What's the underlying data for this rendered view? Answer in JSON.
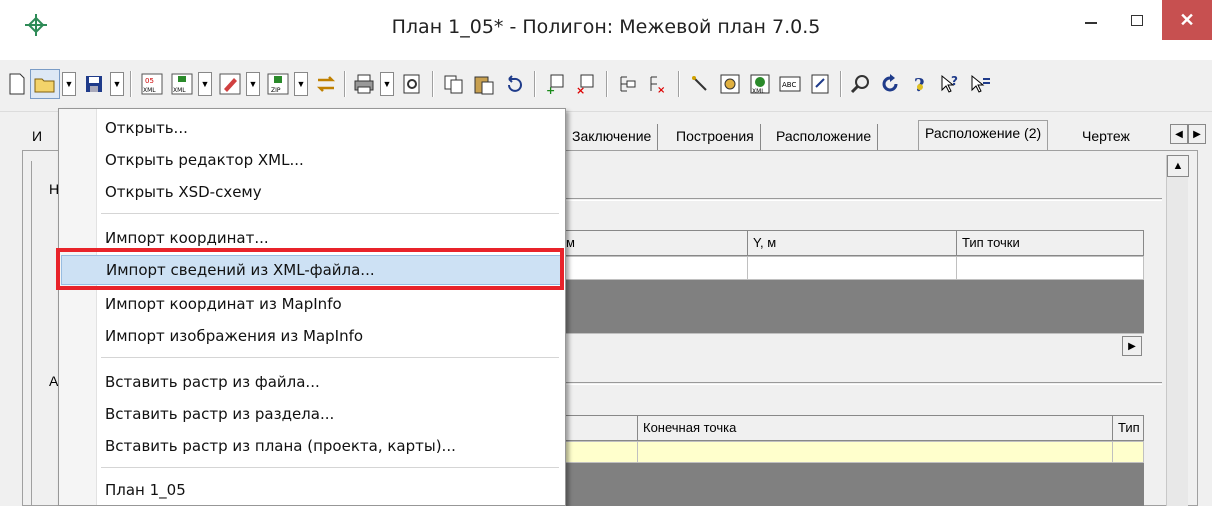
{
  "window": {
    "title": "План 1_05* - Полигон: Межевой план 7.0.5",
    "close_glyph": "✕"
  },
  "toolbar": {
    "icons": [
      "new-file-icon",
      "open-folder-icon",
      "save-icon",
      "export-xml-icon",
      "import-xml-icon",
      "edit-icon",
      "zip-icon",
      "exchange-icon",
      "print-icon",
      "preview-icon",
      "copy-icon",
      "paste-icon",
      "undo-icon",
      "add-point-icon",
      "delete-point-icon",
      "add-node-icon",
      "delete-node-icon",
      "draw-icon",
      "scan-icon",
      "xml-check-icon",
      "abc-icon",
      "frame-icon",
      "search-icon",
      "refresh-icon",
      "help-icon",
      "context-help-icon",
      "options-icon"
    ]
  },
  "tabs": {
    "partial_first": "И",
    "items": [
      "Заключение",
      "Построения",
      "Расположение",
      "Расположение (2)",
      "Чертеж"
    ],
    "active_index": 3
  },
  "content": {
    "left_letters": [
      "Н",
      "А"
    ]
  },
  "grid1": {
    "columns": [
      "м",
      "Y, м",
      "Тип точки"
    ]
  },
  "grid2": {
    "columns": [
      "Конечная точка",
      "Тип"
    ]
  },
  "menu": {
    "items": [
      "Открыть...",
      "Открыть редактор XML...",
      "Открыть XSD-схему",
      "Импорт координат...",
      "Импорт сведений из XML-файла...",
      "Импорт координат из MapInfo",
      "Импорт изображения из MapInfo",
      "Вставить растр из файла...",
      "Вставить растр из раздела...",
      "Вставить растр из плана (проекта, карты)...",
      "План 1_05"
    ],
    "highlighted_index": 4
  },
  "colors": {
    "highlight": "#cde1f4",
    "annotation_red": "#e8232a",
    "close_button": "#c75050",
    "grid_gray": "#808080",
    "grid_yellow": "#ffffcc"
  }
}
